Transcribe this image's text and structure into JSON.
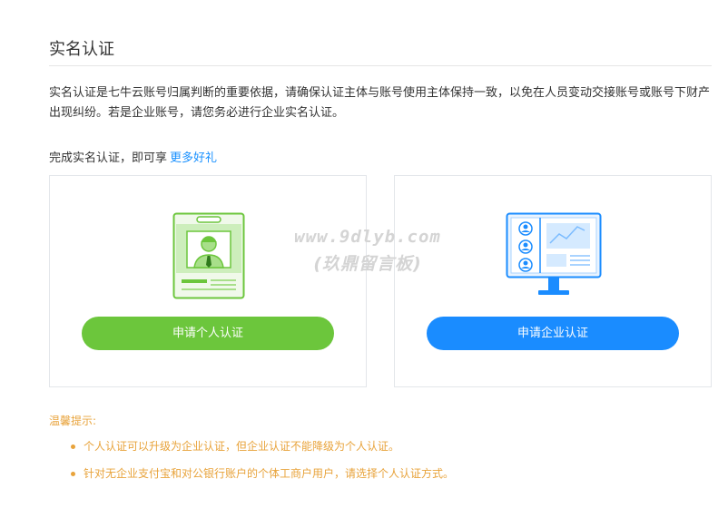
{
  "page": {
    "title": "实名认证",
    "description": "实名认证是七牛云账号归属判断的重要依据，请确保认证主体与账号使用主体保持一致，以免在人员变动交接账号或账号下财产出现纠纷。若是企业账号，请您务必进行企业实名认证。",
    "benefit_prefix": "完成实名认证，即可享",
    "benefit_link": "更多好礼"
  },
  "cards": {
    "personal": {
      "button_label": "申请个人认证",
      "icon": "id-badge-icon",
      "color": "#6cc63c"
    },
    "enterprise": {
      "button_label": "申请企业认证",
      "icon": "monitor-dashboard-icon",
      "color": "#1a8cff"
    }
  },
  "watermark": {
    "line1": "www.9dlyb.com",
    "line2": "(玖鼎留言板)"
  },
  "tips": {
    "title": "温馨提示:",
    "items": [
      "个人认证可以升级为企业认证，但企业认证不能降级为个人认证。",
      "针对无企业支付宝和对公银行账户的个体工商户用户，请选择个人认证方式。"
    ],
    "color": "#e8a33b"
  }
}
